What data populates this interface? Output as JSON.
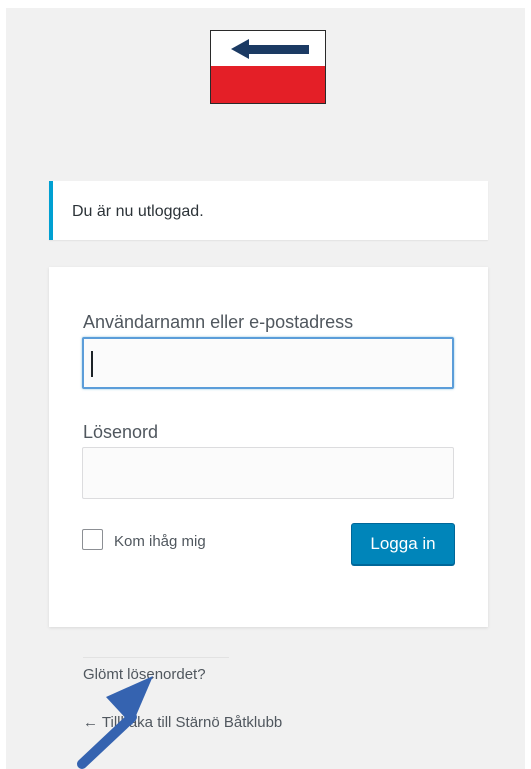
{
  "notice": {
    "message": "Du är nu utloggad."
  },
  "login_form": {
    "username_label": "Användarnamn eller e-postadress",
    "username_value": "",
    "password_label": "Lösenord",
    "password_value": "",
    "remember_label": "Kom ihåg mig",
    "remember_checked": false,
    "submit_label": "Logga in"
  },
  "links": {
    "lost_password": "Glömt lösenordet?",
    "back_to_site": "← Tillbaka till Stärnö Båtklubb"
  },
  "colors": {
    "accent_button": "#0085ba",
    "notice_border": "#00a0d2",
    "logo_red": "#e41f27",
    "logo_arrow": "#1b3a63",
    "annotation_arrow": "#3563b0"
  },
  "icons": {
    "logo": "club-flag-logo",
    "annotation": "pointer-arrow-icon"
  }
}
